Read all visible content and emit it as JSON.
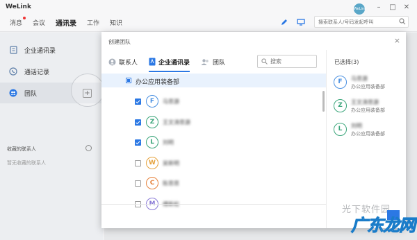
{
  "app": {
    "title": "WeLink",
    "avatar_text": "WeLink"
  },
  "nav": [
    {
      "label": "消息",
      "badge": true
    },
    {
      "label": "会议",
      "badge": false
    },
    {
      "label": "通讯录",
      "badge": false,
      "active": true
    },
    {
      "label": "工作",
      "badge": false
    },
    {
      "label": "知识",
      "badge": false
    }
  ],
  "top_search": {
    "placeholder": "搜索联系人/号码发起呼叫"
  },
  "window_controls": {
    "minimize": "–",
    "maximize": "□",
    "close": "✕"
  },
  "sidebar": {
    "items": [
      {
        "label": "企业通讯录",
        "icon": "directory-icon"
      },
      {
        "label": "通话记录",
        "icon": "phone-icon"
      },
      {
        "label": "团队",
        "icon": "team-icon",
        "active": true
      }
    ],
    "fav_title": "收藏的联系人",
    "fav_empty": "暂无收藏的联系人",
    "add_symbol": "+"
  },
  "modal": {
    "title": "创建团队",
    "close": "×",
    "tabs": [
      {
        "label": "联系人",
        "icon": "contact-icon"
      },
      {
        "label": "企业通讯录",
        "icon": "directory-icon",
        "active": true
      },
      {
        "label": "团队",
        "icon": "team-icon"
      }
    ],
    "search_placeholder": "搜索",
    "department": "办公应用装备部",
    "members": [
      {
        "initial": "F",
        "name": "马思源",
        "checked": true,
        "color": "#4a90e2"
      },
      {
        "initial": "Z",
        "name": "王文涛思源",
        "checked": true,
        "color": "#3aa57a"
      },
      {
        "initial": "L",
        "name": "刘明",
        "checked": true,
        "color": "#3aa57a"
      },
      {
        "initial": "W",
        "name": "吴新明",
        "checked": false,
        "color": "#e6a23c"
      },
      {
        "initial": "C",
        "name": "陈思思",
        "checked": false,
        "color": "#e6823c"
      },
      {
        "initial": "M",
        "name": "傅新松",
        "checked": false,
        "color": "#8a7ad6"
      }
    ],
    "selected_title": "已选择(3)",
    "selected": [
      {
        "initial": "F",
        "name": "马思源",
        "dept": "办公应用装备部",
        "color": "#4a90e2"
      },
      {
        "initial": "Z",
        "name": "王文涛思源",
        "dept": "办公应用装备部",
        "color": "#3aa57a"
      },
      {
        "initial": "L",
        "name": "刘明",
        "dept": "办公应用装备部",
        "color": "#3aa57a"
      }
    ]
  },
  "watermark": {
    "text": "广东龙网",
    "sub": "光下软件园"
  }
}
